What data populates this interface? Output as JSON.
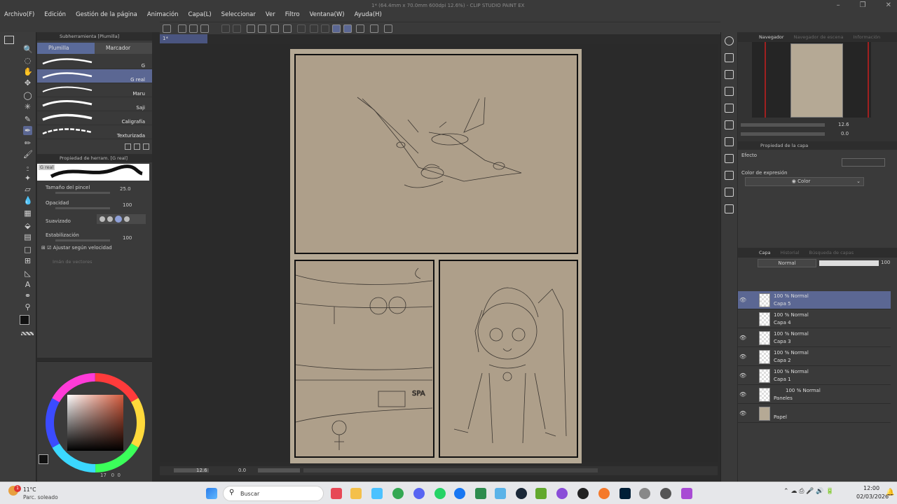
{
  "window": {
    "title": "1* (64.4mm x 70.0mm 600dpi 12.6%) - CLIP STUDIO PAINT EX"
  },
  "menu": [
    "Archivo(F)",
    "Edición",
    "Gestión de la página",
    "Animación",
    "Capa(L)",
    "Seleccionar",
    "Ver",
    "Filtro",
    "Ventana(W)",
    "Ayuda(H)"
  ],
  "canvas_tab": "1*",
  "subtool": {
    "header": "Subherramienta [Plumilla]",
    "tabs": [
      "Plumilla",
      "Marcador"
    ],
    "brushes": [
      "G",
      "G real",
      "Maru",
      "Saji",
      "Caligrafía",
      "Texturizada"
    ],
    "selected_index": 1
  },
  "toolprop": {
    "header": "Propiedad de herram. [G real]",
    "preview_label": "G real",
    "brush_size_label": "Tamaño del pincel",
    "brush_size": "25.0",
    "opacity_label": "Opacidad",
    "opacity": "100",
    "smoothing_label": "Suavizado",
    "stabilization_label": "Estabilización",
    "stabilization": "100",
    "speed_label": "Ajustar según velocidad",
    "vector_label": "Imán de vectores"
  },
  "canvas_status": {
    "zoom": "12.6",
    "angle": "0.0"
  },
  "color_status": {
    "value": "17",
    "x": "0",
    "y": "0"
  },
  "navigator": {
    "tabs": [
      "Navegador",
      "Navegador de escena",
      "Información"
    ],
    "zoom": "12.6",
    "angle": "0.0"
  },
  "layer_property": {
    "header": "Propiedad de la capa",
    "effect_label": "Efecto",
    "expression_label": "Color de expresión",
    "expression_value": "Color"
  },
  "layers": {
    "tabs": [
      "Capa",
      "Historial",
      "Búsqueda de capas"
    ],
    "blend_mode": "Normal",
    "opacity": "100",
    "items": [
      {
        "mode": "100 % Normal",
        "name": "Capa 5"
      },
      {
        "mode": "100 % Normal",
        "name": "Capa 4"
      },
      {
        "mode": "100 % Normal",
        "name": "Capa 3"
      },
      {
        "mode": "100 % Normal",
        "name": "Capa 2"
      },
      {
        "mode": "100 % Normal",
        "name": "Capa 1"
      },
      {
        "mode": "100 % Normal",
        "name": "Paneles"
      },
      {
        "mode": "",
        "name": "Papel"
      }
    ]
  },
  "taskbar": {
    "weather_temp": "11°C",
    "weather_desc": "Parc. soleado",
    "search_placeholder": "Buscar",
    "time": "12:00",
    "date": "02/03/2026",
    "notification_count": "1"
  },
  "colors": {
    "accent": "#5b6793",
    "paper": "#b5a995",
    "panel_fill": "#ae9f8a"
  }
}
